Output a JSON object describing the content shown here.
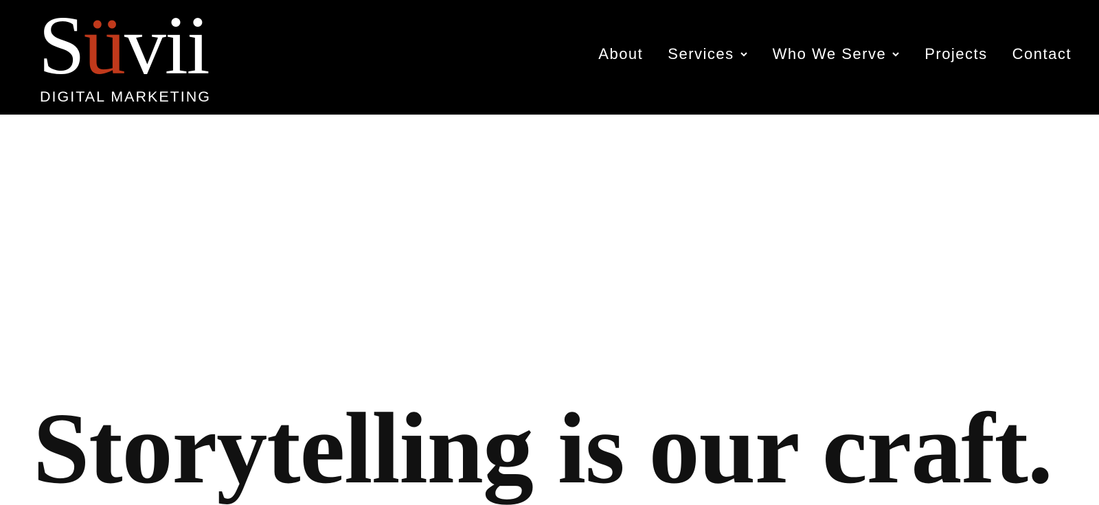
{
  "brand": {
    "name_prefix": "S",
    "name_accent": "ü",
    "name_suffix": "vii",
    "tagline": "DIGITAL MARKETING",
    "accent_color": "#c0391b"
  },
  "nav": {
    "items": [
      {
        "label": "About",
        "has_dropdown": false
      },
      {
        "label": "Services",
        "has_dropdown": true,
        "icon": "chevron-down-icon"
      },
      {
        "label": "Who We Serve",
        "has_dropdown": true,
        "icon": "chevron-down-icon"
      },
      {
        "label": "Projects",
        "has_dropdown": false
      },
      {
        "label": "Contact",
        "has_dropdown": false
      }
    ]
  },
  "hero": {
    "headline": "Storytelling is our craft."
  },
  "colors": {
    "header_bg": "#000000",
    "page_bg": "#ffffff",
    "headline": "#111111"
  }
}
